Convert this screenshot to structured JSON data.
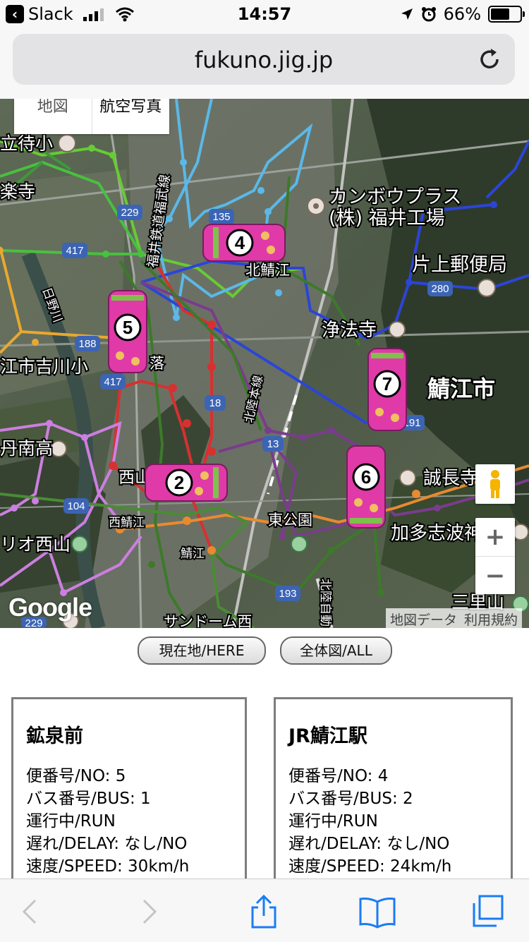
{
  "status": {
    "back_app": "Slack",
    "time": "14:57",
    "battery": "66%",
    "battery_level": 0.66
  },
  "browser": {
    "url": "fukuno.jig.jp"
  },
  "map": {
    "type_buttons": [
      "地図",
      "航空写真"
    ],
    "labels": {
      "kanbo": "カンボウプラス",
      "kanbo2": "(株) 福井工場",
      "katakami": "片上郵便局",
      "kitasabae": "北鯖江",
      "jouhouji": "浄法寺",
      "sabae_city": "鯖江市",
      "yoshikawa": "江市吉川小",
      "nannan": "丹南高",
      "seichoji": "誠長寺",
      "katashiba": "加多志波神",
      "rio": "リオ西山",
      "sundome": "サンドーム西",
      "sanriyama": "三里山",
      "tachimachi": "立待小",
      "kotera": "楽寺",
      "ochi": "落",
      "hino": "日野川",
      "nishiyama": "西山",
      "nishisabae": "西鯖江",
      "sabae_stn": "鯖江",
      "higashi": "東公園",
      "fukubu": "福井鉄道福武線",
      "hokuriku": "北陸本線",
      "hokuriku2": "北陸自動"
    },
    "road_numbers": [
      "229",
      "417",
      "188",
      "417",
      "104",
      "229",
      "135",
      "193",
      "191",
      "18",
      "13",
      "280"
    ],
    "google": "Google",
    "attribution": [
      "地図データ",
      "利用規約"
    ],
    "zoom_in": "+",
    "zoom_out": "−",
    "buses": [
      {
        "num": "4"
      },
      {
        "num": "5"
      },
      {
        "num": "7"
      },
      {
        "num": "2"
      },
      {
        "num": "6"
      }
    ]
  },
  "buttons": {
    "here": "現在地/HERE",
    "all": "全体図/ALL"
  },
  "cards": [
    {
      "title": "鉱泉前",
      "no": "便番号/NO: 5",
      "bus": "バス番号/BUS: 1",
      "run": "運行中/RUN",
      "delay": "遅れ/DELAY: なし/NO",
      "speed": "速度/SPEED: 30km/h"
    },
    {
      "title": "JR鯖江駅",
      "no": "便番号/NO: 4",
      "bus": "バス番号/BUS: 2",
      "run": "運行中/RUN",
      "delay": "遅れ/DELAY: なし/NO",
      "speed": "速度/SPEED: 24km/h"
    }
  ]
}
